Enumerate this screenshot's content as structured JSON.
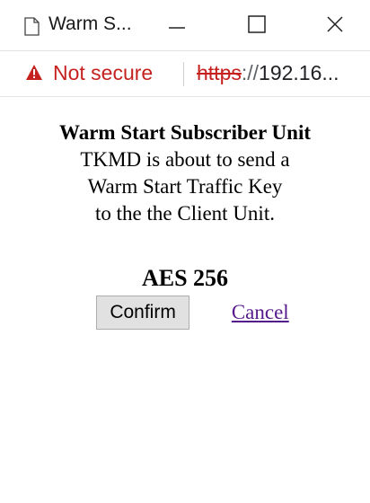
{
  "window": {
    "title": "Warm S...",
    "page_icon": "page-icon",
    "minimize_icon": "minimize-icon",
    "maximize_icon": "maximize-icon",
    "close_icon": "close-icon"
  },
  "address_bar": {
    "warning_icon": "warning-triangle-icon",
    "security_label": "Not secure",
    "url_scheme": "https",
    "url_separator": "://",
    "url_host": "192.16...",
    "colors": {
      "insecure": "#c5221f"
    }
  },
  "dialog": {
    "heading": "Warm Start Subscriber Unit",
    "message_lines": [
      "TKMD is about to send a",
      "Warm Start Traffic Key",
      "to the the Client Unit."
    ],
    "algorithm": "AES 256",
    "confirm_label": "Confirm",
    "cancel_label": "Cancel"
  }
}
